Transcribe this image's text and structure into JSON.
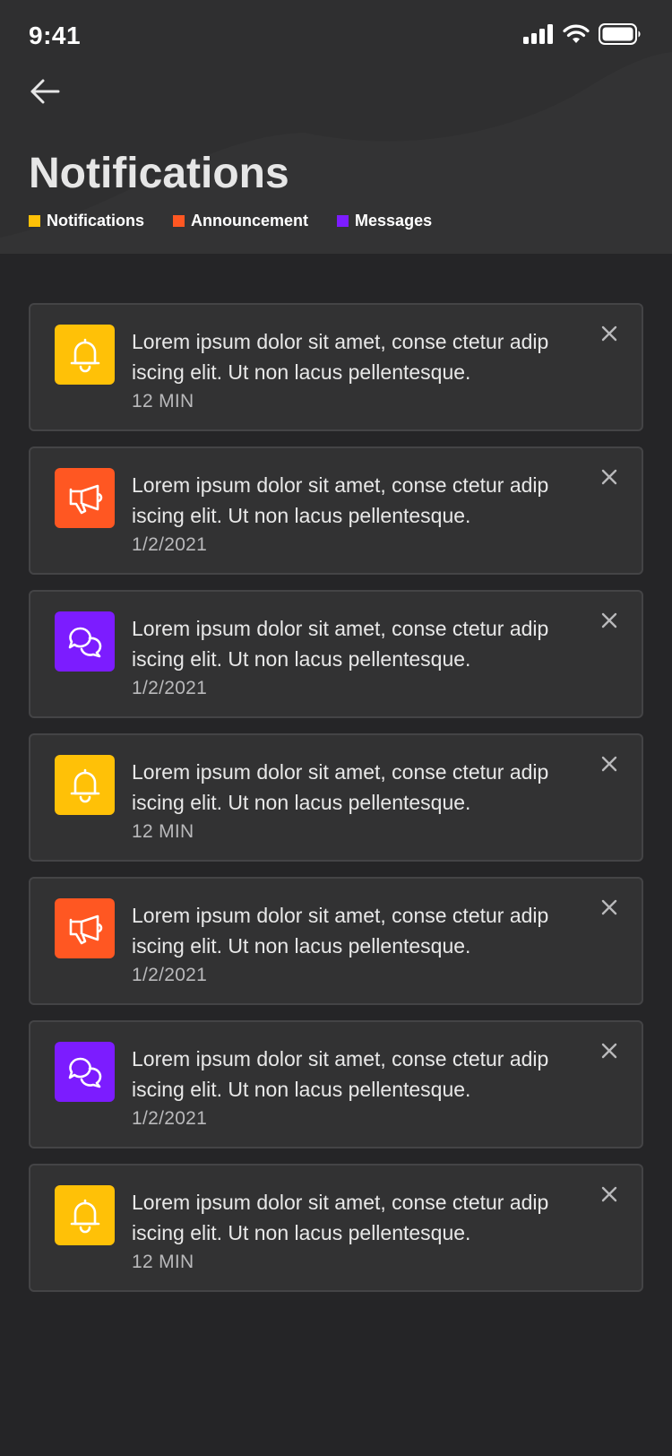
{
  "status_bar": {
    "time": "9:41"
  },
  "header": {
    "title": "Notifications",
    "legend": [
      {
        "label": "Notifications",
        "color": "#ffc107"
      },
      {
        "label": "Announcement",
        "color": "#ff5722"
      },
      {
        "label": "Messages",
        "color": "#7c1cff"
      }
    ]
  },
  "colors": {
    "notification": "#ffc107",
    "announcement": "#ff5722",
    "message": "#7c1cff"
  },
  "notifications": [
    {
      "type": "notification",
      "icon": "bell-icon",
      "text": "Lorem ipsum dolor sit amet, conse ctetur adip iscing elit. Ut non lacus pellentesque.",
      "time": "12 MIN"
    },
    {
      "type": "announcement",
      "icon": "megaphone-icon",
      "text": "Lorem ipsum dolor sit amet, conse ctetur adip iscing elit. Ut non lacus pellentesque.",
      "time": "1/2/2021"
    },
    {
      "type": "message",
      "icon": "chat-bubbles-icon",
      "text": "Lorem ipsum dolor sit amet, conse ctetur adip iscing elit. Ut non lacus pellentesque.",
      "time": "1/2/2021"
    },
    {
      "type": "notification",
      "icon": "bell-icon",
      "text": "Lorem ipsum dolor sit amet, conse ctetur adip iscing elit. Ut non lacus pellentesque.",
      "time": "12 MIN"
    },
    {
      "type": "announcement",
      "icon": "megaphone-icon",
      "text": "Lorem ipsum dolor sit amet, conse ctetur adip iscing elit. Ut non lacus pellentesque.",
      "time": "1/2/2021"
    },
    {
      "type": "message",
      "icon": "chat-bubbles-icon",
      "text": "Lorem ipsum dolor sit amet, conse ctetur adip iscing elit. Ut non lacus pellentesque.",
      "time": "1/2/2021"
    },
    {
      "type": "notification",
      "icon": "bell-icon",
      "text": "Lorem ipsum dolor sit amet, conse ctetur adip iscing elit. Ut non lacus pellentesque.",
      "time": "12 MIN"
    }
  ]
}
